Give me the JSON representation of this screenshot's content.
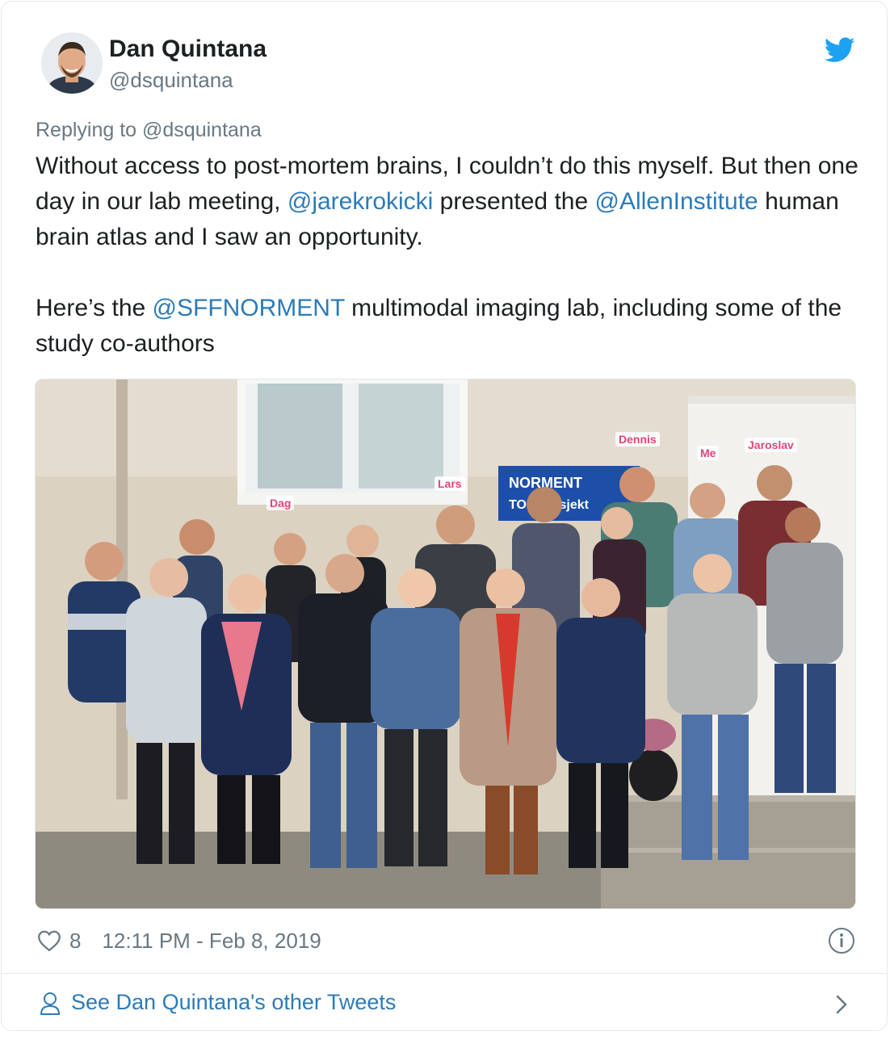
{
  "author": {
    "name": "Dan Quintana",
    "handle": "@dsquintana"
  },
  "reply_context": "Replying to @dsquintana",
  "tweet": {
    "p1_a": "Without access to post-mortem brains, I couldn’t do this myself. But then one day in our lab meeting, ",
    "p1_mention1": "@jarekrokicki",
    "p1_b": " presented the ",
    "p1_mention2": "@AllenInstitute",
    "p1_c": " human brain atlas and I saw an opportunity.",
    "p2_a": "Here’s the ",
    "p2_mention": "@SFFNORMENT",
    "p2_b": " multimodal imaging lab, including some of the study co-authors"
  },
  "photo": {
    "sign_line1": "NORMENT",
    "sign_line2": "TOP prosjekt",
    "tags": {
      "dag": "Dag",
      "lars": "Lars",
      "dennis": "Dennis",
      "me": "Me",
      "jaroslav": "Jaroslav"
    }
  },
  "footer": {
    "like_count": "8",
    "timestamp": "12:11 PM - Feb 8, 2019",
    "see_more": "See Dan Quintana's other Tweets"
  },
  "colors": {
    "link": "#2b7bb9",
    "brand": "#1da1f2",
    "muted": "#697882",
    "tag": "#e0457b"
  },
  "icons": [
    "twitter-bird-icon",
    "heart-icon",
    "info-icon",
    "person-icon",
    "chevron-right-icon"
  ]
}
